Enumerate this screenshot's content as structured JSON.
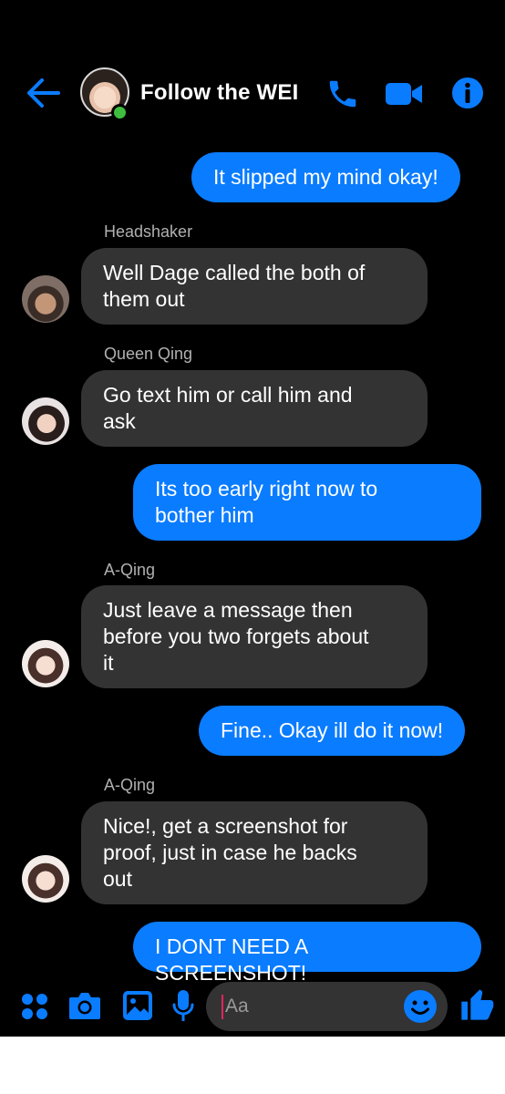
{
  "header": {
    "back_icon": "arrow-left-icon",
    "title": "Follow the WEI",
    "online": true,
    "call_icon": "phone-icon",
    "video_icon": "video-camera-icon",
    "info_icon": "info-icon"
  },
  "colors": {
    "accent": "#0a7cff",
    "background": "#000000",
    "incoming_bubble": "#333333",
    "outgoing_bubble": "#0a7cff",
    "online_dot": "#3fbd3f",
    "cursor": "#e0245e"
  },
  "messages": [
    {
      "direction": "outgoing",
      "text": "It slipped my mind okay!"
    },
    {
      "direction": "incoming",
      "sender": "Headshaker",
      "lines": [
        "Well Dage called the both of",
        "them out"
      ]
    },
    {
      "direction": "incoming",
      "sender": "Queen Qing",
      "lines": [
        "Go text him or call him and",
        "ask"
      ]
    },
    {
      "direction": "outgoing",
      "lines": [
        "Its too early right now to",
        "bother him"
      ]
    },
    {
      "direction": "incoming",
      "sender": "A-Qing",
      "lines": [
        "Just leave a message then",
        "before you two forgets about",
        "it"
      ]
    },
    {
      "direction": "outgoing",
      "text": "Fine.. Okay ill do it now!"
    },
    {
      "direction": "incoming",
      "sender": "A-Qing",
      "lines": [
        "Nice!, get a screenshot for",
        "proof, just in case he backs",
        "out"
      ]
    },
    {
      "direction": "outgoing",
      "text": "I DONT NEED A SCREENSHOT!"
    }
  ],
  "composer": {
    "placeholder": "Aa",
    "apps_icon": "apps-grid-icon",
    "camera_icon": "camera-icon",
    "gallery_icon": "image-gallery-icon",
    "mic_icon": "microphone-icon",
    "emoji_icon": "emoji-smile-icon",
    "like_icon": "thumbs-up-icon"
  }
}
